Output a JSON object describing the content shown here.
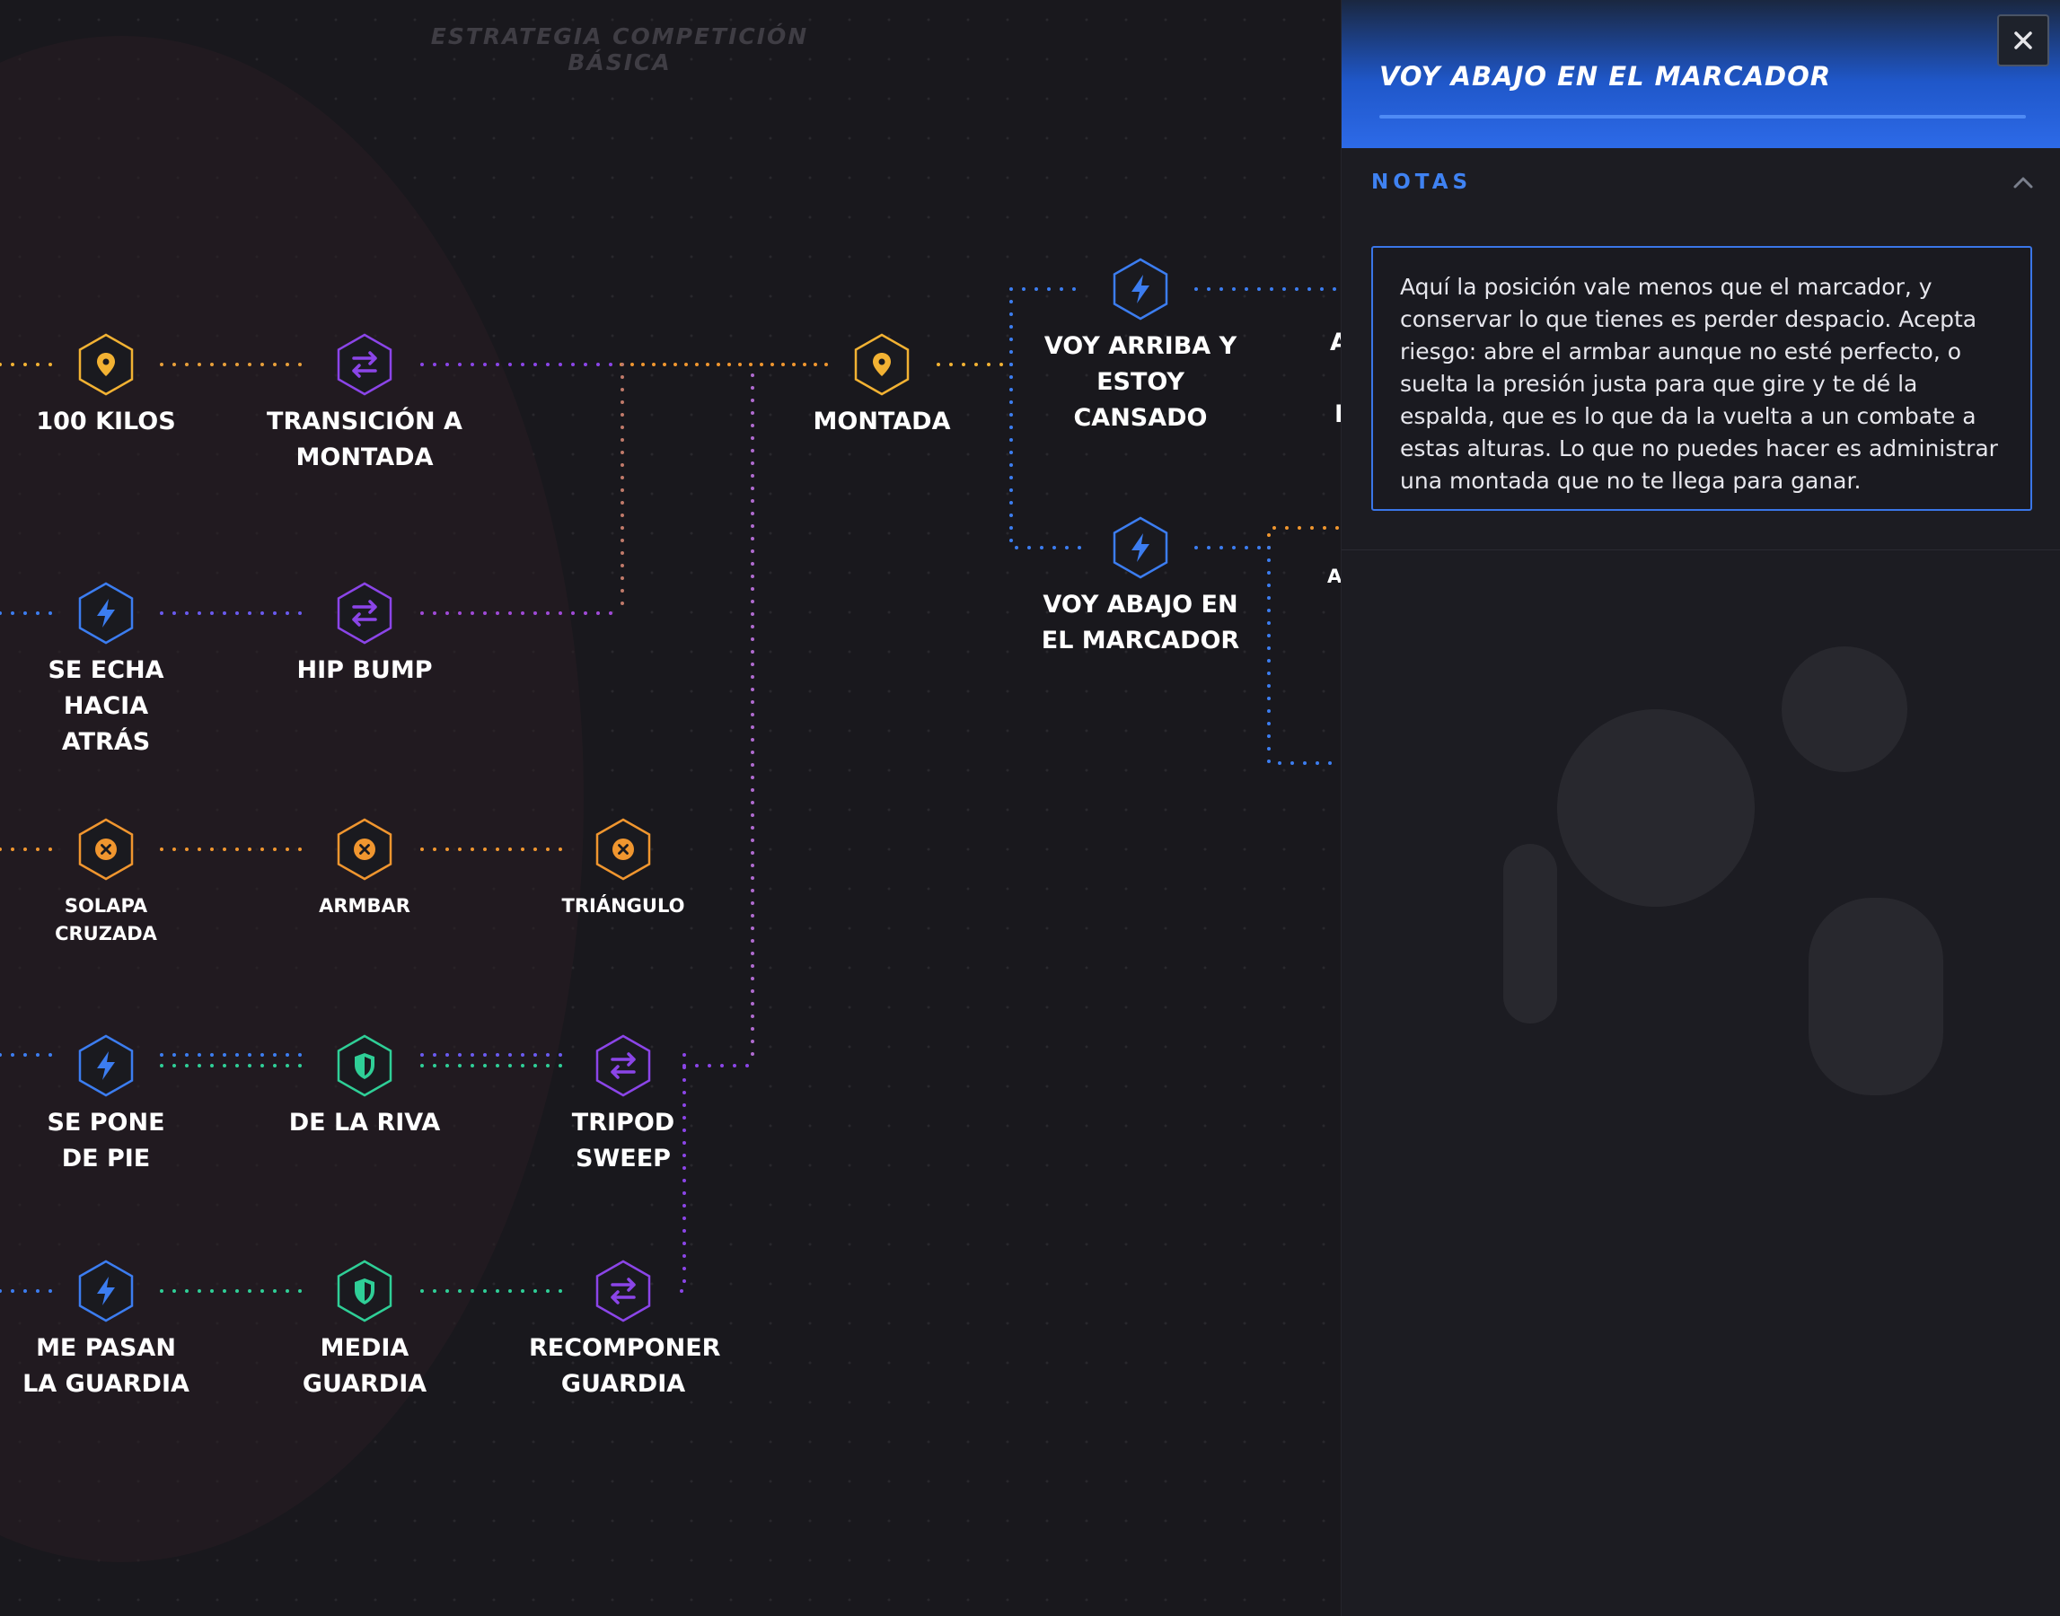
{
  "canvas": {
    "title": "ESTRATEGIA COMPETICIÓN BÁSICA",
    "colors": {
      "yellow": "#f2b233",
      "purple": "#8b45e8",
      "blue": "#3c7df0",
      "green": "#2fcf97",
      "orange": "#f0962f"
    },
    "nodes": {
      "cien_kilos": {
        "label": "100 KILOS",
        "icon": "map-pin-icon"
      },
      "transicion_montada": {
        "label": "TRANSICIÓN A MONTADA",
        "icon": "swap-arrows-icon"
      },
      "montada": {
        "label": "MONTADA",
        "icon": "map-pin-icon"
      },
      "voy_arriba": {
        "label": "VOY ARRIBA Y ESTOY CANSADO",
        "icon": "lightning-icon"
      },
      "voy_abajo": {
        "label": "VOY ABAJO EN EL MARCADOR",
        "icon": "lightning-icon"
      },
      "se_echa": {
        "label": "SE ECHA HACIA ATRÁS",
        "icon": "lightning-icon"
      },
      "hip_bump": {
        "label": "HIP BUMP",
        "icon": "swap-arrows-icon"
      },
      "solapa": {
        "label": "SOLAPA CRUZADA",
        "icon": "submission-x-icon"
      },
      "armbar": {
        "label": "ARMBAR",
        "icon": "submission-x-icon"
      },
      "triangulo": {
        "label": "TRIÁNGULO",
        "icon": "submission-x-icon"
      },
      "se_pone": {
        "label": "SE PONE DE PIE",
        "icon": "lightning-icon"
      },
      "de_la_riva": {
        "label": "DE LA RIVA",
        "icon": "shield-icon"
      },
      "tripod": {
        "label": "TRIPOD SWEEP",
        "icon": "swap-arrows-icon"
      },
      "me_pasan": {
        "label": "ME PASAN LA GUARDIA",
        "icon": "lightning-icon"
      },
      "media_guardia": {
        "label": "MEDIA GUARDIA",
        "icon": "shield-icon"
      },
      "recomponer": {
        "label": "RECOMPONER GUARDIA",
        "icon": "swap-arrows-icon"
      }
    },
    "partial_labels": {
      "upper": "A",
      "upper2": "I",
      "lower": "A"
    }
  },
  "panel": {
    "title": "VOY ABAJO EN EL MARCADOR",
    "close_icon": "close-icon",
    "notes_title": "NOTAS",
    "notes_text": "Aquí la posición vale menos que el marcador, y conservar lo que tienes es perder despacio. Acepta riesgo: abre el armbar aunque no esté perfecto, o suelta la presión justa para que gire y te dé la espalda, que es lo que da la vuelta a un combate a estas alturas. Lo que no puedes hacer es administrar una montada que no te llega para ganar.",
    "accent": "#3a76e8"
  }
}
